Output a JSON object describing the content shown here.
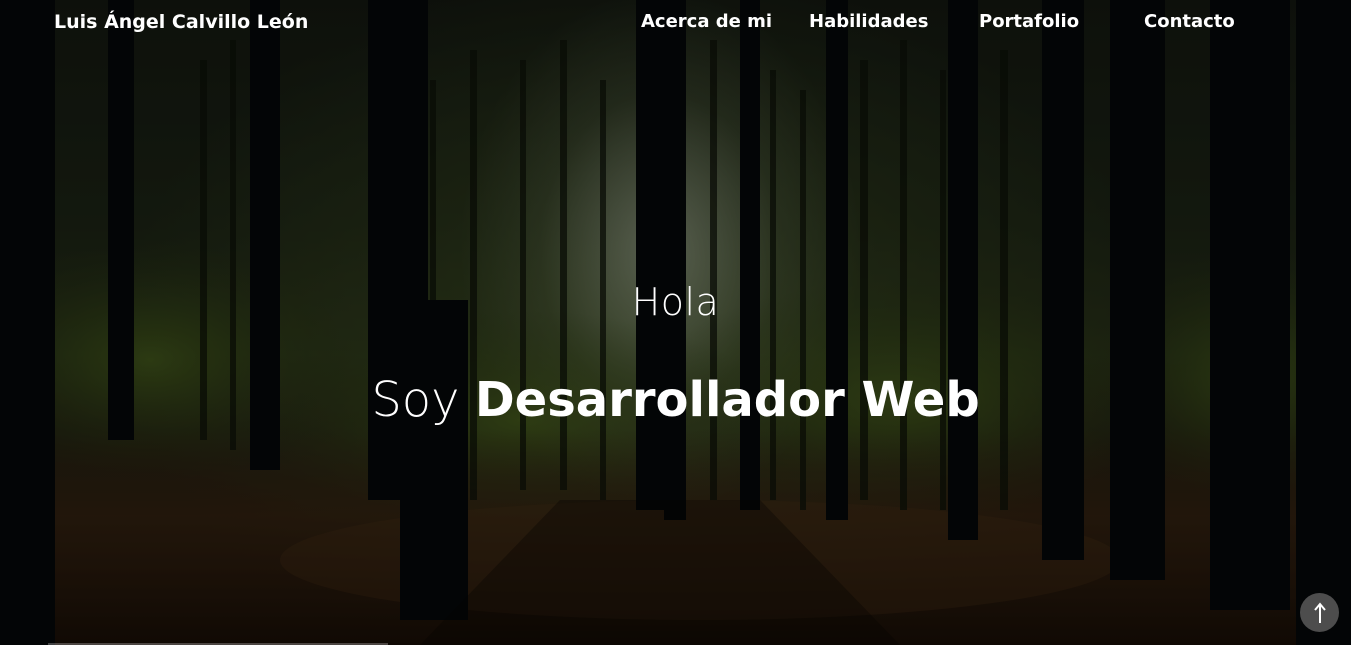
{
  "brand": {
    "name": "Luis Ángel Calvillo León"
  },
  "nav": {
    "items": [
      {
        "label": "Acerca de mi"
      },
      {
        "label": "Habilidades"
      },
      {
        "label": "Portafolio"
      },
      {
        "label": "Contacto"
      }
    ]
  },
  "hero": {
    "greeting": "Hola",
    "headline_prefix": "Soy",
    "headline_role": "Desarrollador Web",
    "background": "forest-photo"
  },
  "scroll_top": {
    "icon": "arrow-up-icon"
  },
  "colors": {
    "text": "#ffffff",
    "overlay": "#000000",
    "scroll_button": "#5a5a5a"
  }
}
